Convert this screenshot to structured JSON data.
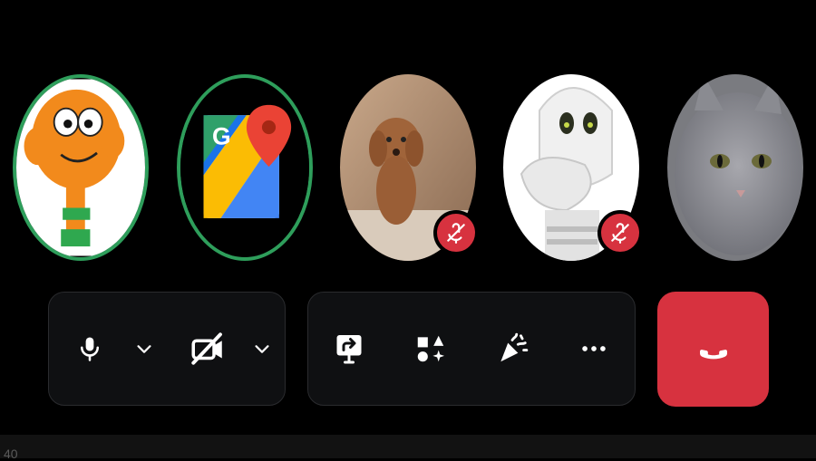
{
  "participants": [
    {
      "id": "p1",
      "avatar": "cartoon-orange-fish",
      "speaking_ring": true,
      "muted": false
    },
    {
      "id": "p2",
      "avatar": "map-pin-logo",
      "speaking_ring": true,
      "muted": false
    },
    {
      "id": "p3",
      "avatar": "poodle-photo",
      "speaking_ring": false,
      "muted": true,
      "status_icon": "mic-off-icon"
    },
    {
      "id": "p4",
      "avatar": "white-plush-figure",
      "speaking_ring": false,
      "muted": true,
      "status_icon": "mic-off-icon"
    },
    {
      "id": "p5",
      "avatar": "grey-cat-photo",
      "speaking_ring": false,
      "muted": false
    }
  ],
  "toolbar": {
    "media_controls": [
      "microphone-icon",
      "chevron-down-icon",
      "camera-off-icon",
      "chevron-down-icon"
    ],
    "actions": [
      "share-screen-icon",
      "effects-icon",
      "reactions-icon",
      "more-icon"
    ],
    "end_call": "end-call-icon"
  },
  "bottom_bar": {
    "text": "40"
  },
  "colors": {
    "background": "#000000",
    "speaking_ring": "#2e9e5b",
    "danger": "#d7323f",
    "toolbar_bg": "#0f1012",
    "icon": "#ffffff"
  }
}
